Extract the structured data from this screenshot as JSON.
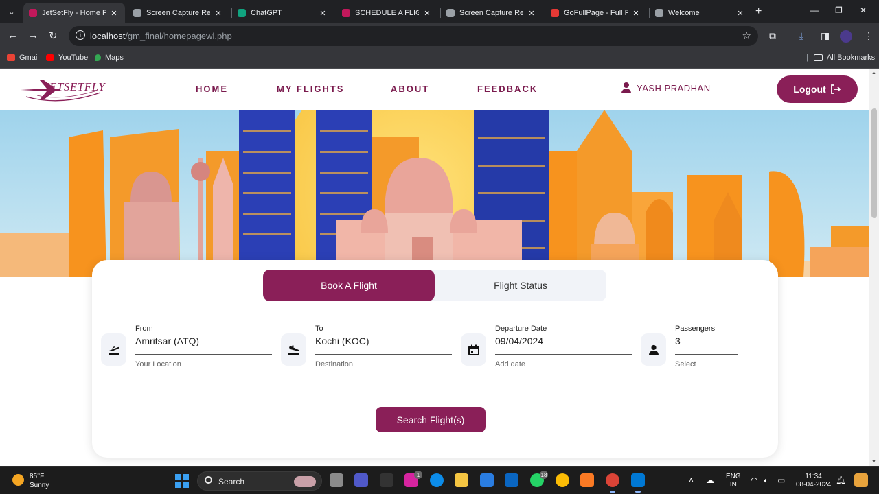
{
  "browser": {
    "tabs": [
      {
        "title": "JetSetFly - Home Page",
        "active": true,
        "favicon_color": "#c2185b"
      },
      {
        "title": "Screen Capture Result",
        "active": false,
        "favicon_color": "#9aa0a6"
      },
      {
        "title": "ChatGPT",
        "active": false,
        "favicon_color": "#10a37f"
      },
      {
        "title": "SCHEDULE A FLIGHT",
        "active": false,
        "favicon_color": "#c2185b"
      },
      {
        "title": "Screen Capture Result",
        "active": false,
        "favicon_color": "#9aa0a6"
      },
      {
        "title": "GoFullPage - Full Page",
        "active": false,
        "favicon_color": "#e53935"
      },
      {
        "title": "Welcome",
        "active": false,
        "favicon_color": "#9aa0a6"
      }
    ],
    "url_host": "localhost",
    "url_path": "/gm_final/homepagewl.php",
    "bookmarks": [
      {
        "label": "Gmail",
        "color": "#ea4335"
      },
      {
        "label": "YouTube",
        "color": "#ff0000"
      },
      {
        "label": "Maps",
        "color": "#34a853"
      }
    ],
    "all_bookmarks": "All Bookmarks"
  },
  "site": {
    "logo": "JETSETFLY",
    "nav": [
      "HOME",
      "MY FLIGHTS",
      "ABOUT",
      "FEEDBACK"
    ],
    "user_name": "YASH PRADHAN",
    "logout_label": "Logout"
  },
  "booking": {
    "tabs": [
      "Book A Flight",
      "Flight Status"
    ],
    "fields": [
      {
        "label": "From",
        "value": "Amritsar (ATQ)",
        "hint": "Your Location",
        "icon": "flight-takeoff-icon"
      },
      {
        "label": "To",
        "value": "Kochi (KOC)",
        "hint": "Destination",
        "icon": "flight-land-icon"
      },
      {
        "label": "Departure Date",
        "value": "09/04/2024",
        "hint": "Add date",
        "icon": "calendar-icon"
      },
      {
        "label": "Passengers",
        "value": "3",
        "hint": "Select",
        "icon": "person-icon"
      }
    ],
    "search_label": "Search Flight(s)"
  },
  "taskbar": {
    "temperature": "85°F",
    "condition": "Sunny",
    "search_label": "Search",
    "language": "ENG",
    "region": "IN",
    "time": "11:34",
    "date": "08-04-2024",
    "instagram_badge": "1",
    "whatsapp_badge": "18"
  },
  "colors": {
    "brand": "#8a1f58",
    "sky": "#a8d8ef",
    "orange": "#f7931e"
  }
}
